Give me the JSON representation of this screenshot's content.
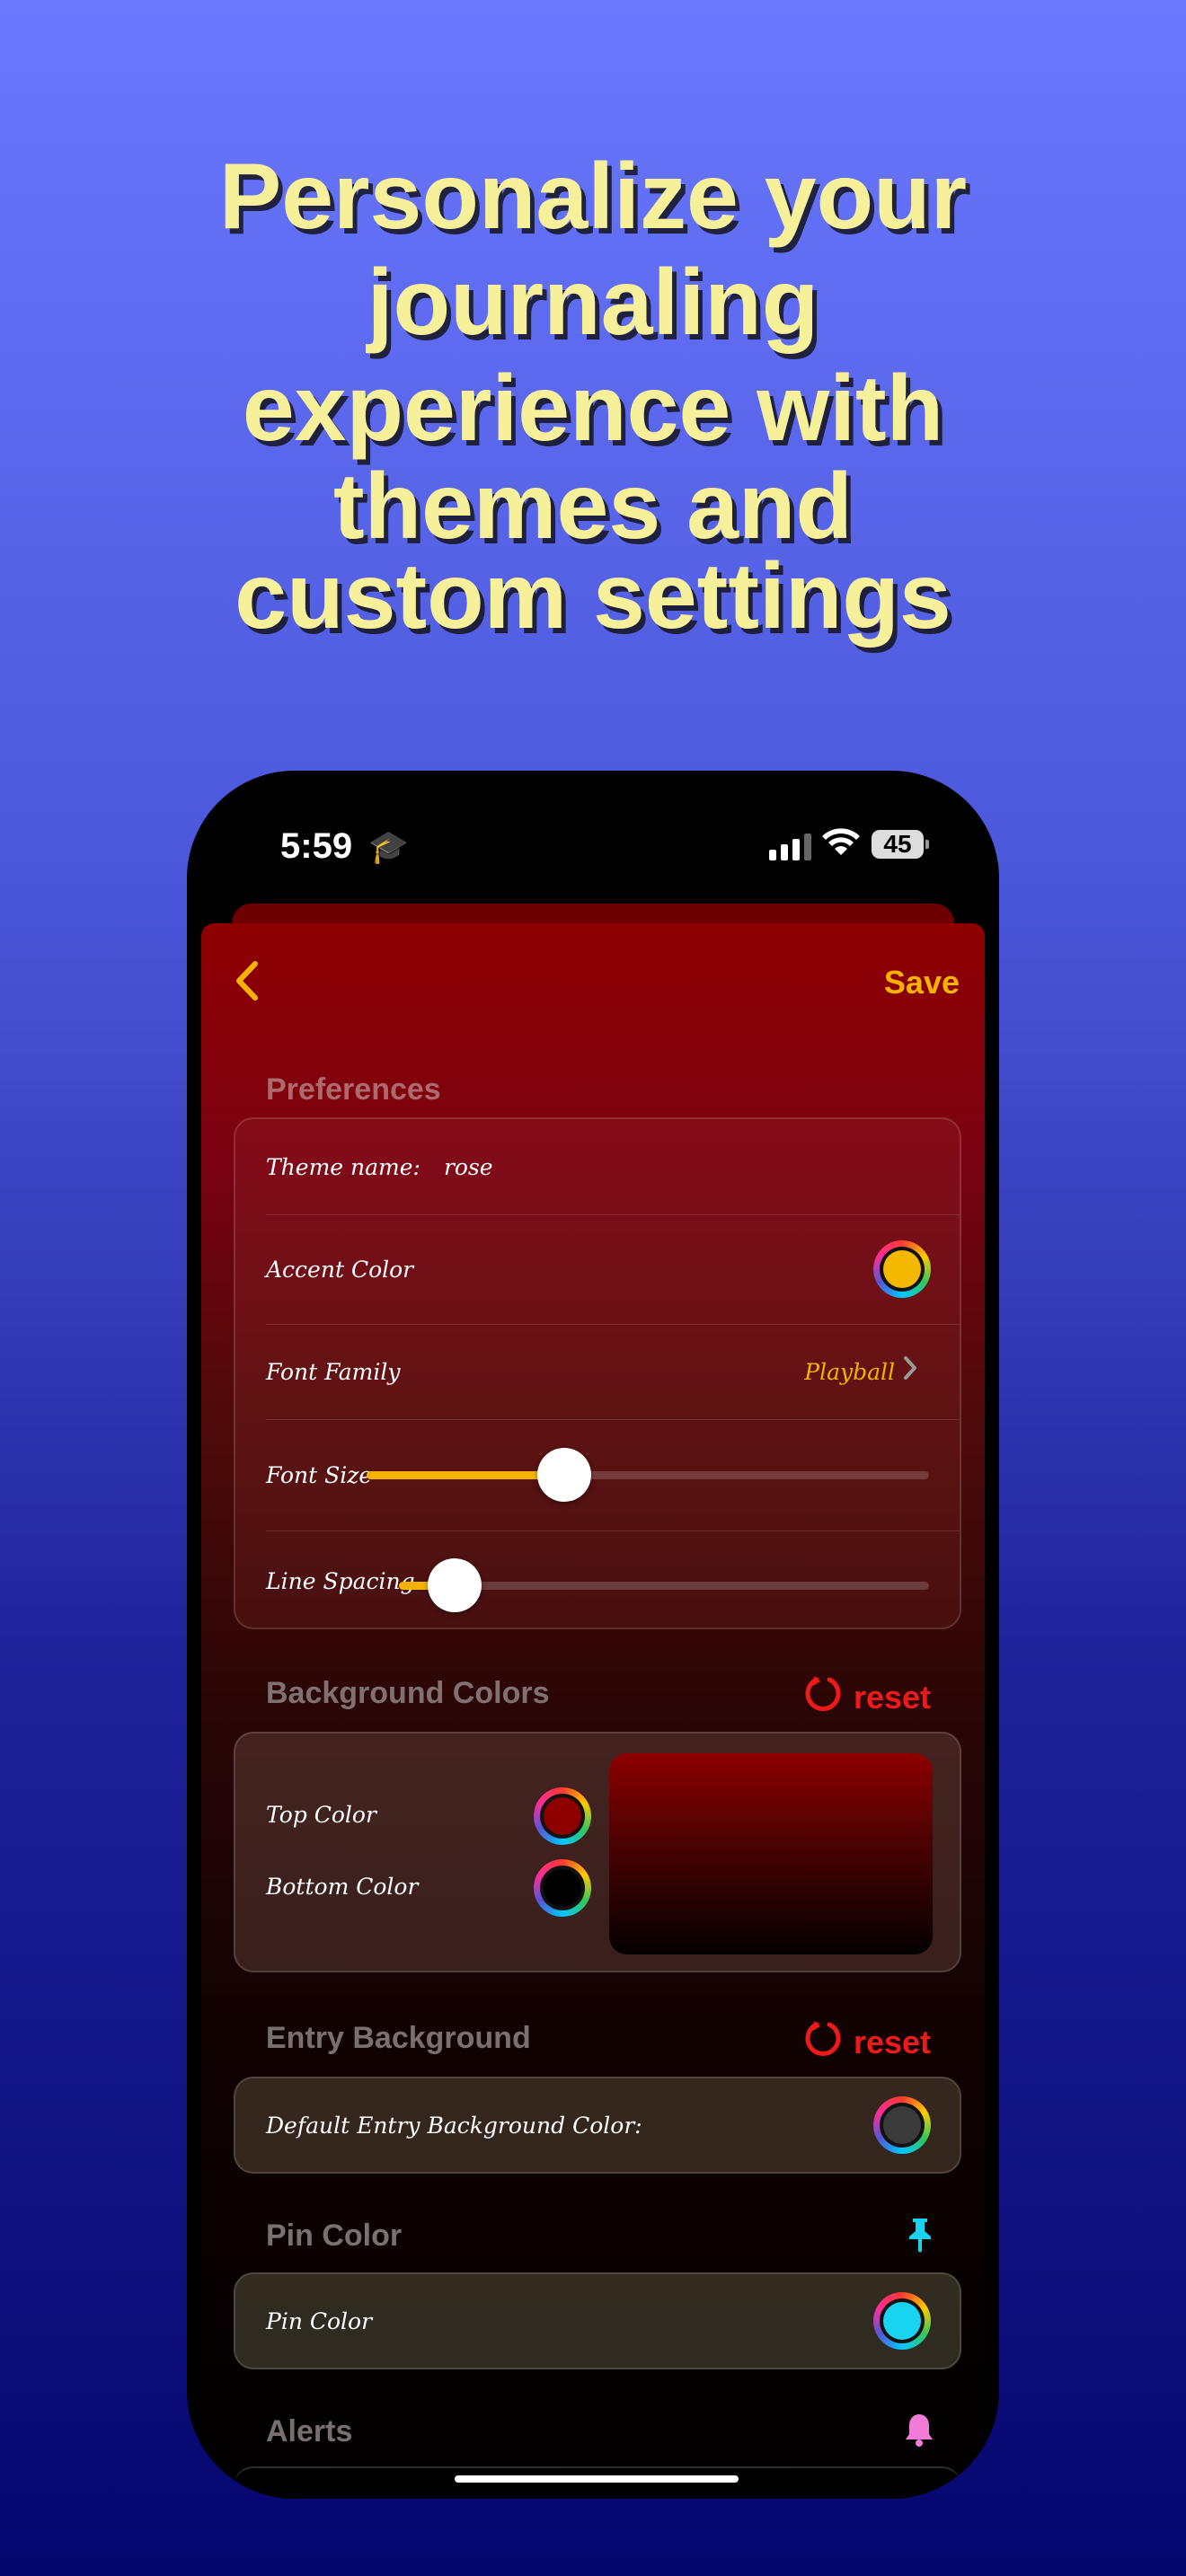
{
  "headline": [
    "Personalize your",
    "journaling",
    "experience with",
    "themes and",
    "custom settings"
  ],
  "status_bar": {
    "time": "5:59",
    "battery": "45"
  },
  "nav": {
    "back_icon": "chevron-left",
    "save_label": "Save"
  },
  "preferences": {
    "title": "Preferences",
    "theme_name_label": "Theme name:",
    "theme_name_value": "rose",
    "accent_color_label": "Accent Color",
    "accent_color": "#f5b800",
    "font_family_label": "Font Family",
    "font_family_value": "Playball",
    "font_size_label": "Font Size",
    "font_size_level": 0.35,
    "line_spacing_label": "Line Spacing",
    "line_spacing_level": 0.1
  },
  "background_colors": {
    "title": "Background Colors",
    "reset_label": "reset",
    "top_color_label": "Top Color",
    "top_color": "#8e0000",
    "bottom_color_label": "Bottom Color",
    "bottom_color": "#000000"
  },
  "entry_background": {
    "title": "Entry Background",
    "reset_label": "reset",
    "default_label": "Default Entry Background Color:",
    "color": "#3b3b3b"
  },
  "pin_color": {
    "title": "Pin Color",
    "label": "Pin Color",
    "color": "#18d4f0"
  },
  "alerts": {
    "title": "Alerts"
  },
  "colors": {
    "accent": "#f5b300",
    "reset": "#ee1a1a",
    "headline": "#f7f09a"
  }
}
